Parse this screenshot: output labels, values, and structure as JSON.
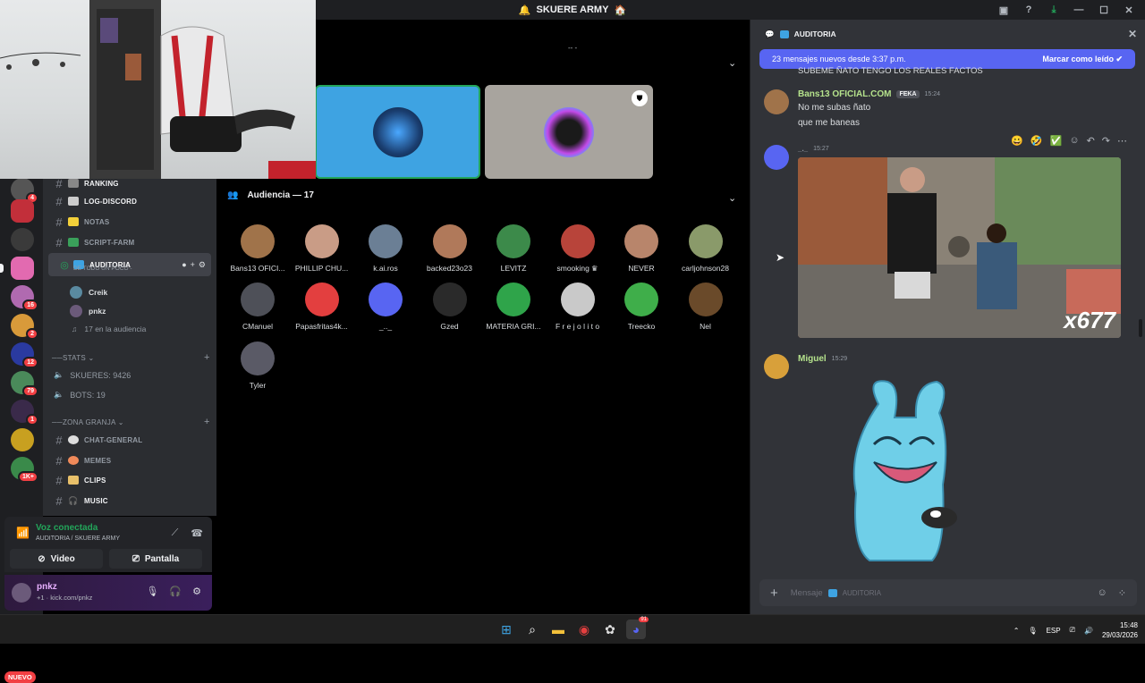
{
  "window": {
    "title": "SKUERE ARMY",
    "title_emoji_left": "🔔",
    "title_emoji_right": "🏠"
  },
  "server_rail": {
    "badges": [
      "4",
      "16",
      "2",
      "12",
      "79",
      "1",
      "1K+"
    ],
    "new_label": "NUEVO"
  },
  "channels": {
    "ranking": "RANKING",
    "log_discord": "LOG-DISCORD",
    "notas": "NOTAS",
    "script_farm": "SCRIPT-FARM",
    "auditoria": "AUDITORIA",
    "auditoria_sub": "DE TODO UN POCO -",
    "members": [
      "Creik",
      "pnkz"
    ],
    "audience_count": "17 en la audiencia",
    "stats_category": "STATS",
    "stats_items": [
      "SKUERES: 9426",
      "BOTS: 19"
    ],
    "zona_category": "ZONA GRANJA",
    "zona_items": [
      "CHAT-GENERAL",
      "MEMES",
      "CLIPS",
      "MUSIC"
    ]
  },
  "voice": {
    "status": "Voz conectada",
    "location": "AUDITORIA / SKUERE ARMY",
    "video_label": "Video",
    "screen_label": "Pantalla"
  },
  "user": {
    "name": "pnkz",
    "status": "kick.com/pnkz",
    "status_prefix": "+1"
  },
  "stage": {
    "audience_header": "Audiencia — 17",
    "dash_label": "-- -",
    "audience": [
      {
        "name": "Bans13 OFICI...",
        "color": "#a0734a"
      },
      {
        "name": "PHILLIP CHU...",
        "color": "#c99c86"
      },
      {
        "name": "k.ai.ros",
        "color": "#6b7f95"
      },
      {
        "name": "backed23o23",
        "color": "#b0795a"
      },
      {
        "name": "LEVITZ",
        "color": "#3c8a4a"
      },
      {
        "name": "smooking",
        "color": "#b8443a",
        "suffix": "♛"
      },
      {
        "name": "NEVER",
        "color": "#b8856b"
      },
      {
        "name": "carljohnson28",
        "color": "#8a9a6a"
      },
      {
        "name": "CManuel",
        "color": "#4e5058"
      },
      {
        "name": "Papasfritas4k...",
        "color": "#e33f3f"
      },
      {
        "name": "_.._",
        "color": "#5865f2"
      },
      {
        "name": "Gzed",
        "color": "#2a2a2a"
      },
      {
        "name": "MATERIA GRI...",
        "color": "#2fa44a"
      },
      {
        "name": "F r e j o l i t o",
        "color": "#c9c9c9"
      },
      {
        "name": "Treecko",
        "color": "#3fae4a"
      },
      {
        "name": "Nel",
        "color": "#6a4a2a"
      },
      {
        "name": "Tyler",
        "color": "#5a5a66"
      }
    ]
  },
  "chat": {
    "channel": "AUDITORIA",
    "new_messages": "23 mensajes nuevos desde 3:37 p.m.",
    "mark_read": "Marcar como leído",
    "cut_message": "SUBEME ÑATO TENGO LOS REALES FACTOS",
    "messages": [
      {
        "author": "Bans13 OFICIAL.COM",
        "tag": "FEKA",
        "time": "15:24",
        "lines": [
          "No me subas ñato",
          "que me baneas"
        ],
        "color": "#b5e28c"
      },
      {
        "author": "_._",
        "time": "15:27",
        "image_caption": "x677",
        "color": "#949ba4"
      },
      {
        "author": "Miguel",
        "time": "15:29",
        "color": "#b5e28c"
      }
    ],
    "composer_placeholder": "Mensaje",
    "composer_channel": "AUDITORIA"
  },
  "taskbar": {
    "lang": "ESP",
    "time": "15:48",
    "date": "29/03/2026",
    "discord_badge": "91"
  }
}
